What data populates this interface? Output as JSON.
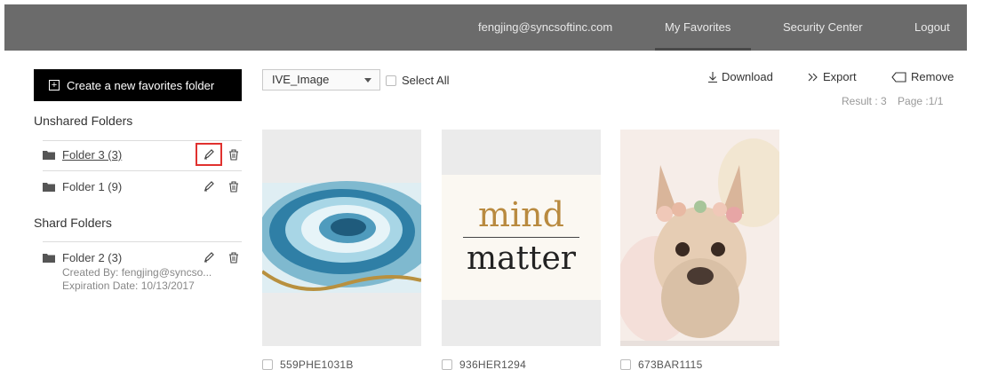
{
  "nav": {
    "email": "fengjing@syncsoftinc.com",
    "favorites": "My Favorites",
    "security": "Security Center",
    "logout": "Logout"
  },
  "sidebar": {
    "create_label": "Create a new favorites folder",
    "unshared_title": "Unshared Folders",
    "shared_title": "Shard Folders",
    "unshared": [
      {
        "label": "Folder 3 (3)"
      },
      {
        "label": "Folder 1 (9)"
      }
    ],
    "shared": [
      {
        "label": "Folder 2 (3)",
        "created_by": "Created By: fengjing@syncso...",
        "expiration": "Expiration Date: 10/13/2017"
      }
    ]
  },
  "toolbar": {
    "select_value": "IVE_Image",
    "select_all": "Select All",
    "download": "Download",
    "export": "Export",
    "remove": "Remove",
    "result": "Result : 3",
    "page": "Page :1/1"
  },
  "items": [
    {
      "id": "559PHE1031B"
    },
    {
      "id": "936HER1294",
      "line1": "mind",
      "line2": "matter"
    },
    {
      "id": "673BAR1115"
    }
  ]
}
